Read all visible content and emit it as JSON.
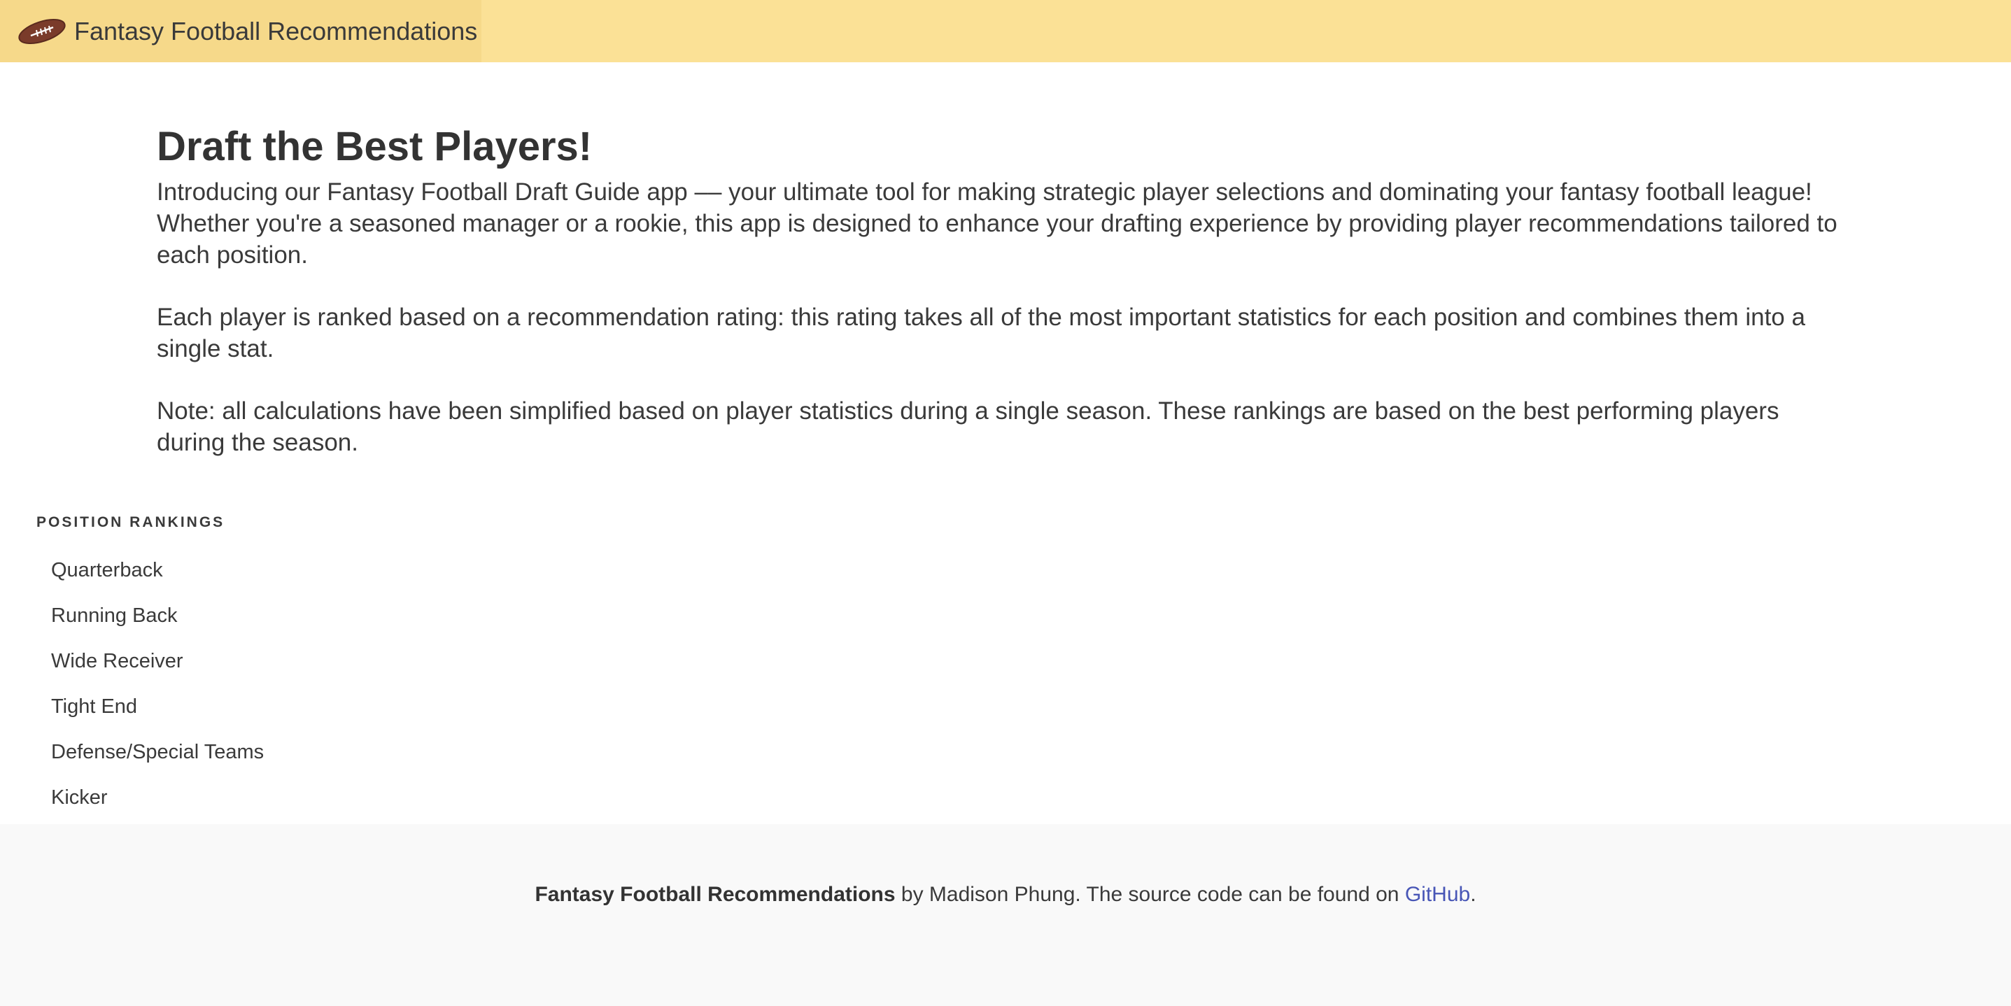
{
  "navbar": {
    "brand_icon": "football-icon",
    "brand_title": "Fantasy Football Recommendations"
  },
  "main": {
    "headline": "Draft the Best Players!",
    "paragraphs": [
      "Introducing our Fantasy Football Draft Guide app –– your ultimate tool for making strategic player selections and dominating your fantasy football league! Whether you're a seasoned manager or a rookie, this app is designed to enhance your drafting experience by providing player recommendations tailored to each position.",
      "Each player is ranked based on a recommendation rating: this rating takes all of the most important statistics for each position and combines them into a single stat.",
      "Note: all calculations have been simplified based on player statistics during a single season. These rankings are based on the best performing players during the season."
    ]
  },
  "sidebar": {
    "title": "POSITION RANKINGS",
    "items": [
      "Quarterback",
      "Running Back",
      "Wide Receiver",
      "Tight End",
      "Defense/Special Teams",
      "Kicker"
    ]
  },
  "footer": {
    "app_name": "Fantasy Football Recommendations",
    "text_middle": " by Madison Phung. The source code can be found on ",
    "link_label": "GitHub",
    "text_end": "."
  },
  "colors": {
    "navbar_bg": "#fbe196",
    "brand_bg": "#f6d98a",
    "link": "#4856b6",
    "footer_bg": "#f9f9f9"
  }
}
